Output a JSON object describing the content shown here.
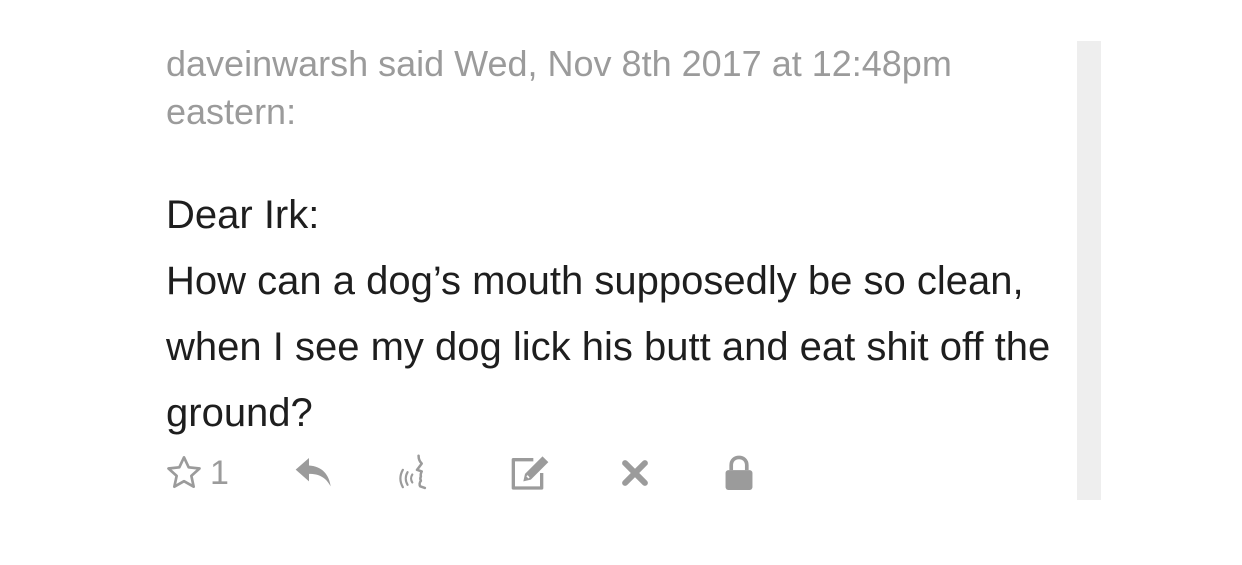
{
  "comment": {
    "meta_line": "daveinwarsh said Wed, Nov 8th 2017 at 12:48pm eastern:",
    "greeting": "Dear Irk:",
    "body": "How can a dog’s mouth supposedly be so clean, when I see my dog lick his butt and eat shit off the ground?"
  },
  "actions": {
    "star_count": "1",
    "icons": [
      "star-icon",
      "reply-icon",
      "speak-icon",
      "edit-icon",
      "delete-icon",
      "lock-icon"
    ],
    "icon_color": "#9b9b9b"
  },
  "colors": {
    "meta_text": "#9b9b9b",
    "body_text": "#1e1e1e",
    "scrollbar": "#eeeeee"
  }
}
